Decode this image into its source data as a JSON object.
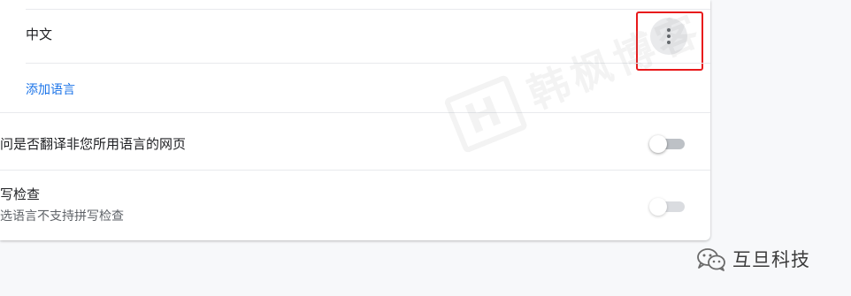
{
  "languages": {
    "items": [
      {
        "label": "中文"
      }
    ],
    "add_language_label": "添加语言"
  },
  "settings": {
    "translate_prompt": {
      "label": "询问是否翻译非您所用语言的网页",
      "label_visible": "问是否翻译非您所用语言的网页",
      "enabled": false
    },
    "spell_check": {
      "title_visible": "写检查",
      "subtitle_visible": "选语言不支持拼写检查",
      "enabled": false,
      "disabled": true
    }
  },
  "watermark": {
    "text": "韩枫博客"
  },
  "wechat_footer": {
    "account_name": "互旦科技"
  },
  "colors": {
    "link": "#1a73e8",
    "highlight": "#e8191b",
    "toggle_off_track": "#bdc1c6",
    "toggle_disabled_track": "#dadce0"
  }
}
